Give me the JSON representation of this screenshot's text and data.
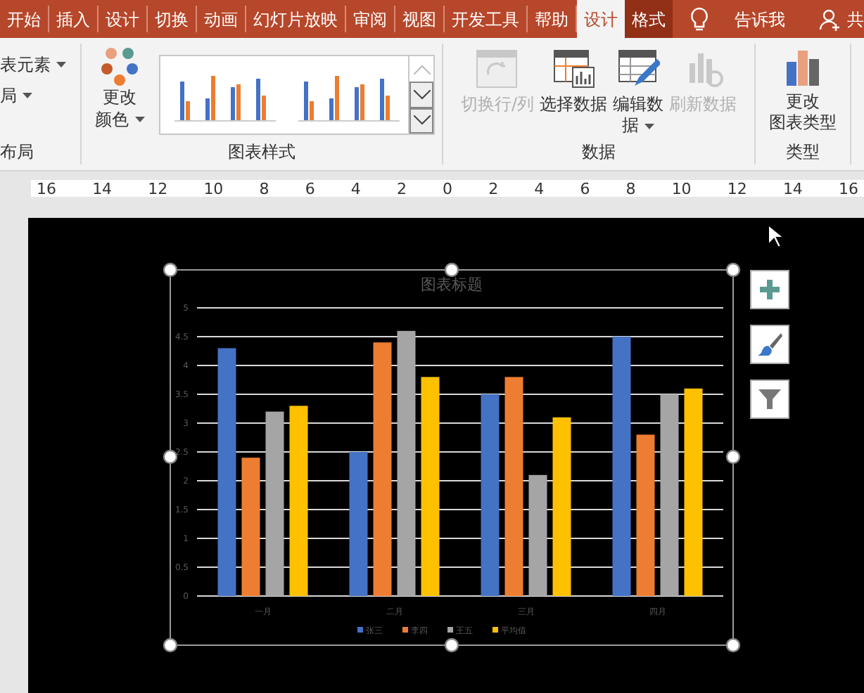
{
  "tabs": [
    {
      "label": "开始",
      "selected": false,
      "kind": "tab"
    },
    {
      "label": "插入",
      "selected": false,
      "kind": "tab"
    },
    {
      "label": "设计",
      "selected": false,
      "kind": "tab"
    },
    {
      "label": "切换",
      "selected": false,
      "kind": "tab"
    },
    {
      "label": "动画",
      "selected": false,
      "kind": "tab"
    },
    {
      "label": "幻灯片放映",
      "selected": false,
      "kind": "tab"
    },
    {
      "label": "审阅",
      "selected": false,
      "kind": "tab"
    },
    {
      "label": "视图",
      "selected": false,
      "kind": "tab"
    },
    {
      "label": "开发工具",
      "selected": false,
      "kind": "tab"
    },
    {
      "label": "帮助",
      "selected": false,
      "kind": "tab"
    },
    {
      "label": "设计",
      "selected": true,
      "kind": "context"
    },
    {
      "label": "格式",
      "selected": false,
      "kind": "context"
    }
  ],
  "tell_me": "告诉我",
  "share": "共",
  "ribbon": {
    "layout_group": {
      "items": [
        "表元素",
        "局"
      ],
      "label": "布局"
    },
    "styles_group": {
      "change_colors": [
        "更改",
        "颜色"
      ],
      "label": "图表样式"
    },
    "data_group": {
      "buttons": [
        {
          "label": "切换行/列",
          "disabled": true,
          "kind": "switch"
        },
        {
          "label": "选择数据",
          "disabled": false,
          "kind": "select"
        },
        {
          "label": "编辑数",
          "label_2": "据",
          "disabled": false,
          "kind": "edit"
        },
        {
          "label": "刷新数据",
          "disabled": true,
          "kind": "refresh"
        }
      ],
      "label": "数据"
    },
    "type_group": {
      "button": [
        "更改",
        "图表类型"
      ],
      "label": "类型"
    }
  },
  "ruler": [
    "16",
    "14",
    "12",
    "10",
    "8",
    "6",
    "4",
    "2",
    "0",
    "2",
    "4",
    "6",
    "8",
    "10",
    "12",
    "14",
    "16"
  ],
  "chart": {
    "chart_data": {
      "type": "bar",
      "title": "图表标题",
      "categories": [
        "一月",
        "二月",
        "三月",
        "四月"
      ],
      "series": [
        {
          "name": "张三",
          "color": "#4472c4",
          "values": [
            4.3,
            2.5,
            3.5,
            4.5
          ]
        },
        {
          "name": "李四",
          "color": "#ed7d31",
          "values": [
            2.4,
            4.4,
            3.8,
            2.8
          ]
        },
        {
          "name": "王五",
          "color": "#a5a5a5",
          "values": [
            3.2,
            4.6,
            2.1,
            3.5
          ]
        },
        {
          "name": "平均值",
          "color": "#ffc000",
          "values": [
            3.3,
            3.8,
            3.1,
            3.6
          ]
        }
      ],
      "ylim": [
        0,
        5
      ],
      "grid": true,
      "legend": true,
      "yticks": [
        {
          "value": 0,
          "label": "0"
        },
        {
          "value": 0.5,
          "label": "0.5"
        },
        {
          "value": 1,
          "label": "1"
        },
        {
          "value": 1.5,
          "label": "1.5"
        },
        {
          "value": 2,
          "label": "2"
        },
        {
          "value": 2.5,
          "label": "2.5"
        },
        {
          "value": 3,
          "label": "3"
        },
        {
          "value": 3.5,
          "label": "3.5"
        },
        {
          "value": 4,
          "label": "4"
        },
        {
          "value": 4.5,
          "label": "4.5"
        },
        {
          "value": 5,
          "label": "5"
        }
      ]
    }
  }
}
